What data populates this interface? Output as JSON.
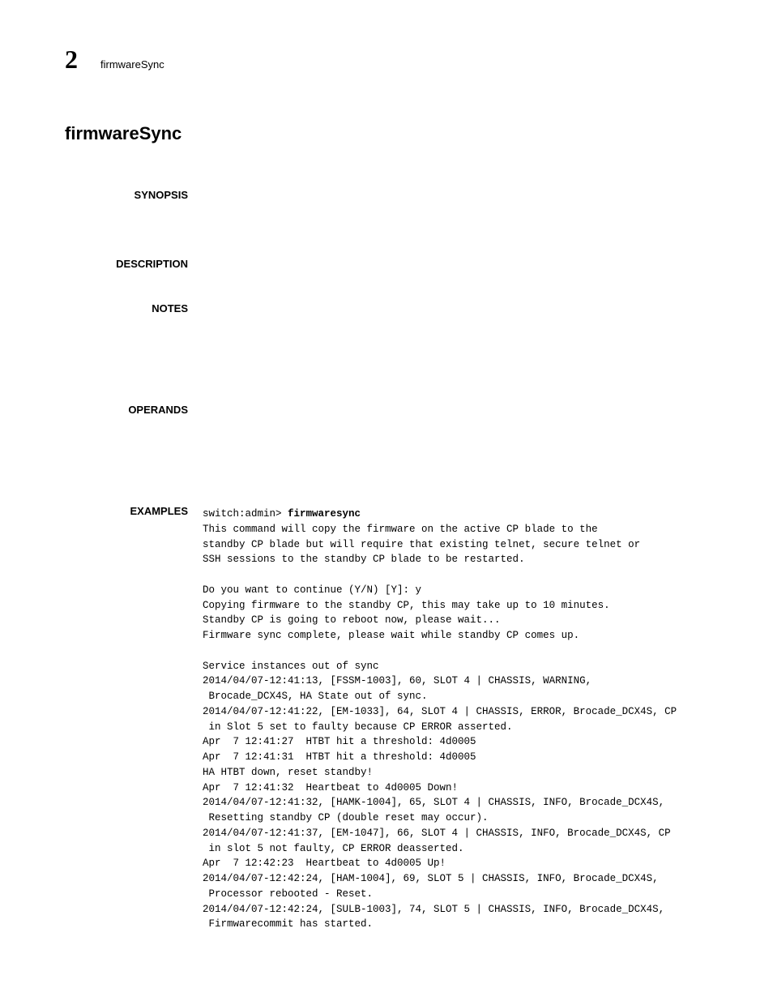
{
  "page_header": {
    "chapter_number": "2",
    "running_title": "firmwareSync"
  },
  "main_heading": "firmwareSync",
  "sections": {
    "synopsis": {
      "label": "SYNOPSIS"
    },
    "description": {
      "label": "DESCRIPTION"
    },
    "notes": {
      "label": "NOTES"
    },
    "operands": {
      "label": "OPERANDS"
    },
    "examples": {
      "label": "EXAMPLES"
    }
  },
  "example_code": {
    "prompt": "switch:admin> ",
    "command": "firmwaresync",
    "body": "\nThis command will copy the firmware on the active CP blade to the\nstandby CP blade but will require that existing telnet, secure telnet or\nSSH sessions to the standby CP blade to be restarted.\n\nDo you want to continue (Y/N) [Y]: y\nCopying firmware to the standby CP, this may take up to 10 minutes.\nStandby CP is going to reboot now, please wait...\nFirmware sync complete, please wait while standby CP comes up.\n\nService instances out of sync\n2014/04/07-12:41:13, [FSSM-1003], 60, SLOT 4 | CHASSIS, WARNING,\n Brocade_DCX4S, HA State out of sync.\n2014/04/07-12:41:22, [EM-1033], 64, SLOT 4 | CHASSIS, ERROR, Brocade_DCX4S, CP\n in Slot 5 set to faulty because CP ERROR asserted.\nApr  7 12:41:27  HTBT hit a threshold: 4d0005\nApr  7 12:41:31  HTBT hit a threshold: 4d0005\nHA HTBT down, reset standby!\nApr  7 12:41:32  Heartbeat to 4d0005 Down!\n2014/04/07-12:41:32, [HAMK-1004], 65, SLOT 4 | CHASSIS, INFO, Brocade_DCX4S,\n Resetting standby CP (double reset may occur).\n2014/04/07-12:41:37, [EM-1047], 66, SLOT 4 | CHASSIS, INFO, Brocade_DCX4S, CP\n in slot 5 not faulty, CP ERROR deasserted.\nApr  7 12:42:23  Heartbeat to 4d0005 Up!\n2014/04/07-12:42:24, [HAM-1004], 69, SLOT 5 | CHASSIS, INFO, Brocade_DCX4S,\n Processor rebooted - Reset.\n2014/04/07-12:42:24, [SULB-1003], 74, SLOT 5 | CHASSIS, INFO, Brocade_DCX4S,\n Firmwarecommit has started."
  }
}
